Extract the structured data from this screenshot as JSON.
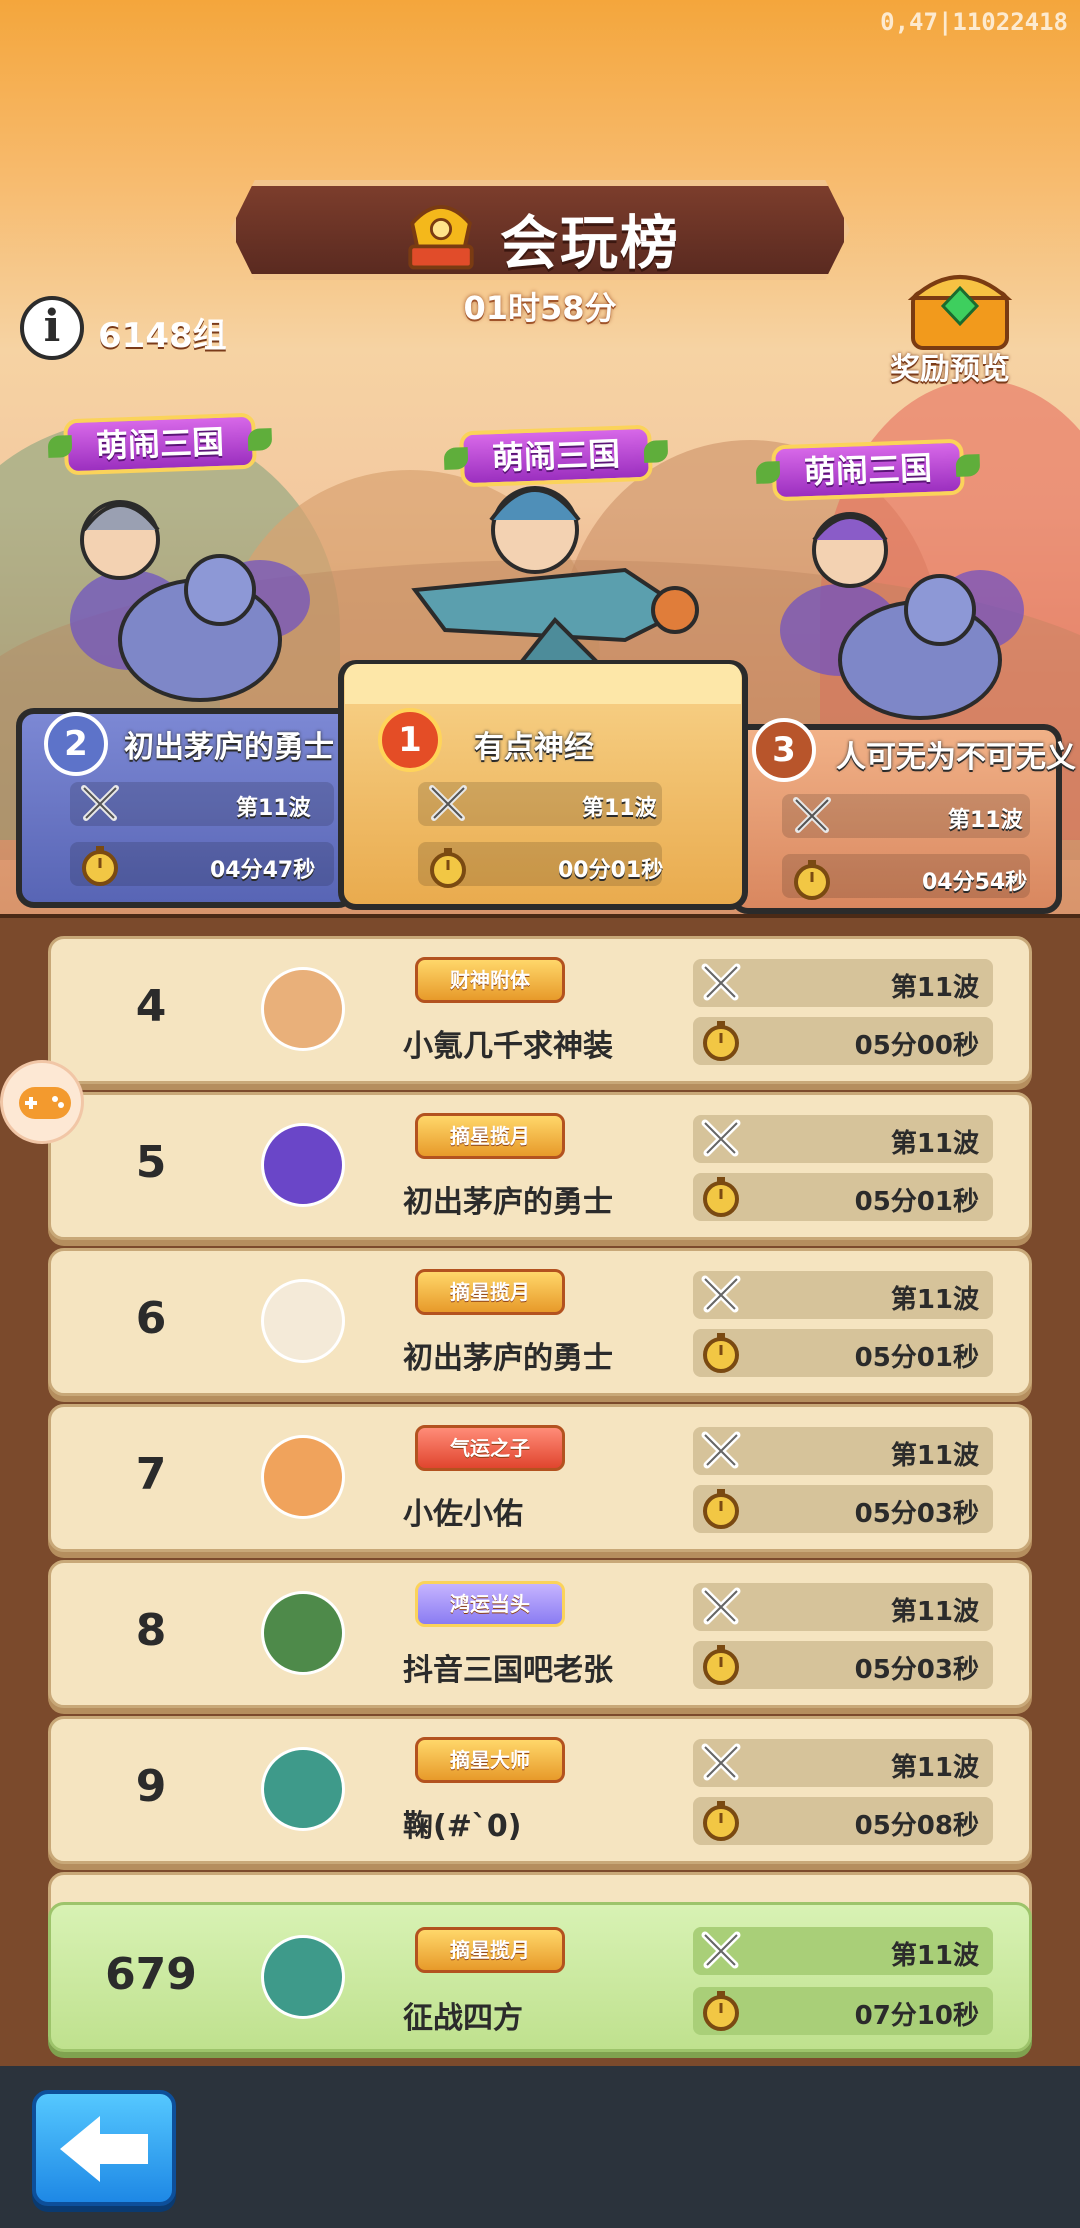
{
  "build_id": "0,47|11022418",
  "header": {
    "title": "会玩榜",
    "countdown": "01时58分",
    "group_count": "6148组",
    "reward_preview_label": "奖励预览"
  },
  "podium": [
    {
      "rank": "2",
      "tag": "萌闹三国",
      "name": "初出茅庐的勇士",
      "wave": "第11波",
      "time": "04分47秒"
    },
    {
      "rank": "1",
      "tag": "萌闹三国",
      "name": "有点神经",
      "wave": "第11波",
      "time": "00分01秒"
    },
    {
      "rank": "3",
      "tag": "萌闹三国",
      "name": "人可无为不可无义",
      "wave": "第11波",
      "time": "04分54秒"
    }
  ],
  "list": [
    {
      "rank": "4",
      "badge": "财神附体",
      "name": "小氪几千求神装",
      "wave": "第11波",
      "time": "05分00秒"
    },
    {
      "rank": "5",
      "badge": "摘星揽月",
      "name": "初出茅庐的勇士",
      "wave": "第11波",
      "time": "05分01秒"
    },
    {
      "rank": "6",
      "badge": "摘星揽月",
      "name": "初出茅庐的勇士",
      "wave": "第11波",
      "time": "05分01秒"
    },
    {
      "rank": "7",
      "badge": "气运之子",
      "name": "小佐小佑",
      "wave": "第11波",
      "time": "05分03秒"
    },
    {
      "rank": "8",
      "badge": "鸿运当头",
      "name": "抖音三国吧老张",
      "wave": "第11波",
      "time": "05分03秒"
    },
    {
      "rank": "9",
      "badge": "摘星大师",
      "name": "鞠(#`0)",
      "wave": "第11波",
      "time": "05分08秒"
    }
  ],
  "my_rank": {
    "rank": "679",
    "badge": "摘星揽月",
    "name": "征战四方",
    "wave": "第11波",
    "time": "07分10秒"
  },
  "icons": {
    "info": "info-icon",
    "trophy": "trophy-icon",
    "chest": "treasure-chest-icon",
    "wave": "crossed-swords-icon",
    "time": "stopwatch-icon",
    "back": "back-arrow-icon",
    "float": "gamepad-icon"
  },
  "colors": {
    "accent": "#f4a63c",
    "panel": "#7b4a2c",
    "row": "#f5e4c0",
    "my_row": "#c9e79e",
    "back": "#1e88e5"
  }
}
